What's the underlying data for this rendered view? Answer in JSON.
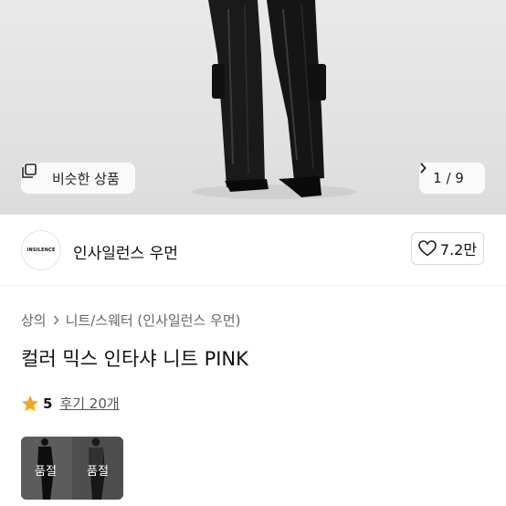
{
  "hero": {
    "similar_label": "비슷한 상품",
    "counter": "1 / 9"
  },
  "shop": {
    "logo_text": "INSILENCE",
    "name": "인사일런스 우먼",
    "likes": "7.2만"
  },
  "breadcrumb": {
    "items": [
      "상의",
      "니트/스웨터 (인사일런스 우먼)"
    ]
  },
  "product": {
    "title": "컬러 믹스 인타샤 니트 PINK",
    "rating": "5",
    "reviews": "후기 20개"
  },
  "thumbnails": {
    "left_label": "품절",
    "right_label": "품절"
  },
  "colors": {
    "star": "#F5A623",
    "sold_out_overlay": "rgba(0,0,0,0.45)"
  }
}
